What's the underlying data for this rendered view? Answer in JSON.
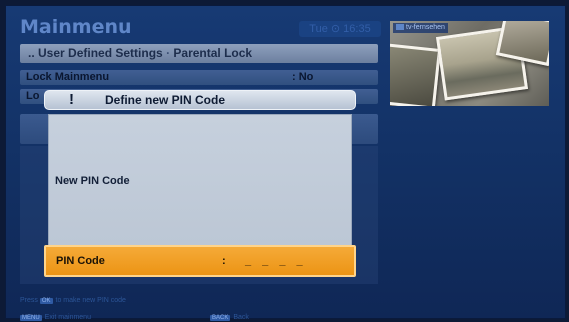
{
  "header": {
    "title": "Mainmenu",
    "clock": "Tue ⊙ 16:35"
  },
  "breadcrumb": {
    "prefix": "..",
    "path": "User Defined Settings",
    "sep": "·",
    "leaf": "Parental Lock"
  },
  "settings": {
    "rows": [
      {
        "label": "Lock Mainmenu",
        "value": ": No"
      },
      {
        "label": "Lo",
        "value": ""
      },
      {
        "label": "",
        "value": ""
      }
    ]
  },
  "preview": {
    "tag": "tv-fernsehen"
  },
  "dialog": {
    "excl": "!",
    "title": "Define new PIN Code",
    "body_label": "New PIN Code",
    "pin_label": "PIN Code",
    "pin_colon": ":",
    "pin_value": "_ _ _ _"
  },
  "hint": {
    "key": "OK",
    "text": "to make new PIN code"
  },
  "footer": {
    "menu_key": "MENU",
    "menu_text": "Exit mainmenu",
    "back_key": "BACK",
    "back_text": "Back"
  }
}
